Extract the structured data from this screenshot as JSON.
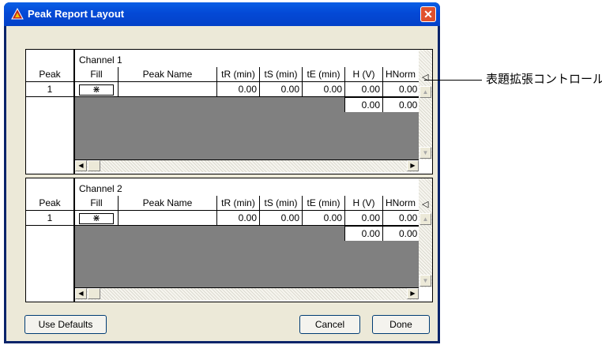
{
  "window": {
    "title": "Peak Report Layout",
    "close_glyph": "✕",
    "icon": "peak-app-icon"
  },
  "channels": [
    {
      "name": "Channel 1",
      "columns": [
        "Peak",
        "Fill",
        "Peak Name",
        "tR (min)",
        "tS (min)",
        "tE (min)",
        "H (V)",
        "HNorm"
      ],
      "row": {
        "peak": "1",
        "fill": "⋇",
        "name": "",
        "tR": "0.00",
        "tS": "0.00",
        "tE": "0.00",
        "H": "0.00",
        "HNorm": "0.00"
      },
      "totals": {
        "H": "0.00",
        "HNorm": "0.00"
      }
    },
    {
      "name": "Channel 2",
      "columns": [
        "Peak",
        "Fill",
        "Peak Name",
        "tR (min)",
        "tS (min)",
        "tE (min)",
        "H (V)",
        "HNorm"
      ],
      "row": {
        "peak": "1",
        "fill": "⋇",
        "name": "",
        "tR": "0.00",
        "tS": "0.00",
        "tE": "0.00",
        "H": "0.00",
        "HNorm": "0.00"
      },
      "totals": {
        "H": "0.00",
        "HNorm": "0.00"
      }
    }
  ],
  "buttons": {
    "use_defaults": "Use Defaults",
    "cancel": "Cancel",
    "done": "Done"
  },
  "glyphs": {
    "expand": "◁",
    "up": "▲",
    "down": "▼",
    "left": "◀",
    "right": "▶"
  },
  "callout": {
    "text": "表題拡張コントロール"
  },
  "colors": {
    "titlebar": "#0449d6",
    "dialog_bg": "#ece9d8",
    "grid_empty": "#808080"
  }
}
